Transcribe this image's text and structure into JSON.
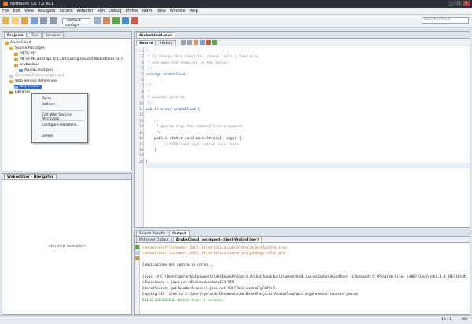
{
  "window": {
    "title": "NetBeans IDE 7.2 RC1"
  },
  "menu": [
    "File",
    "Edit",
    "View",
    "Navigate",
    "Source",
    "Refactor",
    "Run",
    "Debug",
    "Profile",
    "Team",
    "Tools",
    "Window",
    "Help"
  ],
  "toolbar": {
    "config": "<default config>",
    "search_placeholder": "Search (Ctrl+I)"
  },
  "projects_panel": {
    "tabs": [
      "Projects",
      "Files",
      "Services"
    ],
    "tree": [
      "ArubaCloud",
      "Source Packages",
      "META-INF",
      "META-INF.wsdl.api.dc1.computing.cloud.it.WsEndUser.v1.7",
      "arubacloud",
      "ArubaCloud.java",
      "Generated Sources (jax-ws)",
      "Web Service References",
      "WsEndUser",
      "Libraries"
    ]
  },
  "context_menu": [
    "Open",
    "Refresh...",
    "Edit Web Service Attributes...",
    "Configure Handlers...",
    "Delete"
  ],
  "navigator": {
    "title": "WsEndUser - Navigator",
    "empty": "<No View Available>"
  },
  "editor": {
    "file_tab": "ArubaCloud.java",
    "views": [
      "Source",
      "History"
    ],
    "lines": [
      "/*",
      " * To change this template, choose Tools | Templates",
      " * and open the template in the editor.",
      " */",
      "package arubacloud;",
      "",
      "/**",
      " *",
      " * @author gerardo",
      " */",
      "public class ArubaCloud {",
      "",
      "    /**",
      "     * @param args the command line arguments",
      "     */",
      "    public static void main(String[] args) {",
      "        // TODO code application logic here",
      "    }",
      "",
      "}"
    ],
    "line_numbers": [
      "1",
      "2",
      "3",
      "4",
      "5",
      "6",
      "7",
      "8",
      "9",
      "10",
      "11",
      "12",
      "13",
      "14",
      "15",
      "16",
      "17",
      "18",
      "19",
      "20"
    ]
  },
  "output_panel": {
    "tabs": [
      "Search Results",
      "Output"
    ],
    "subtabs": [
      "Retriever Output",
      "ArubaCloud (wsimport-client-WsEndUser)"
    ],
    "lines": [
      "com\\microsoft\\schemas\\_2003\\_10\\serialization\\arrays\\ObjectFactory.java",
      "com\\microsoft\\schemas\\_2003\\_10\\serialization\\arrays\\package-info.java",
      "",
      "Compilazione del codice in corso...",
      "",
      "javac -d C:\\Users\\gerardo\\Documents\\NetBeansProjects\\ArubaCloud\\build\\generated\\jax-wsCache\\WsEndUser -classpath C:\\Program Files (x86)\\Java\\jdk1.6.0_30\\lib\\dt.jar;C:\\P",
      "classLoader = java.net.URLClassLoader@12479f5",
      "SharedSecrets.getJavaNetAccess()=java.net.URLClassLoader$7@2845e3",
      "Copying 319 files to C:\\Users\\gerardo\\Documents\\NetBeansProjects\\ArubaCloud\\build\\generated-sources\\jax-ws",
      "BUILD SUCCESSFUL (total time: 8 seconds)"
    ]
  },
  "status": {
    "position": "19 | 1",
    "mode": "INS"
  }
}
